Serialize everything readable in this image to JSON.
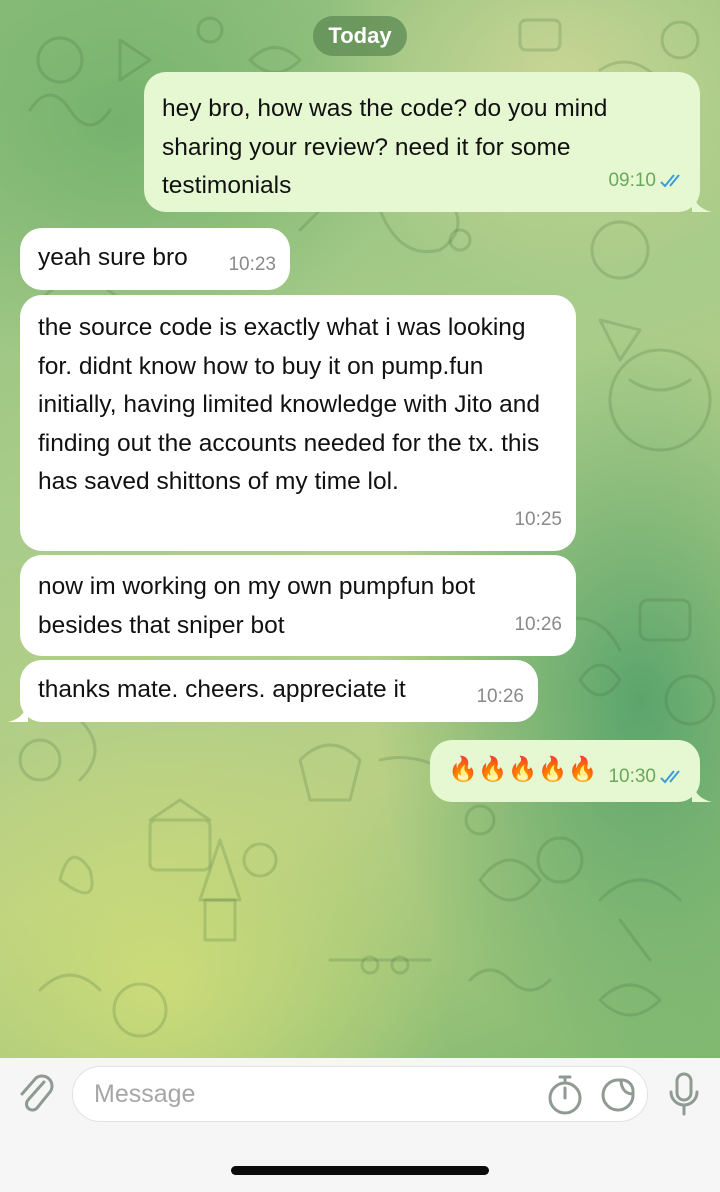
{
  "date_divider": "Today",
  "messages": [
    {
      "direction": "out",
      "text": "hey bro, how was the code? do you mind sharing your review? need it for some testimonials",
      "time": "09:10",
      "read": true
    },
    {
      "direction": "in",
      "text": "yeah sure bro",
      "time": "10:23"
    },
    {
      "direction": "in",
      "text": "the source code is exactly what i was looking for. didnt know how to buy it on pump.fun initially, having limited knowledge with Jito and finding out the accounts needed for the tx. this has saved shittons of my time lol.",
      "time": "10:25"
    },
    {
      "direction": "in",
      "text": "now im working on my own pumpfun bot besides that sniper bot",
      "time": "10:26"
    },
    {
      "direction": "in",
      "text": "thanks mate. cheers. appreciate it",
      "time": "10:26"
    },
    {
      "direction": "out",
      "text": "🔥🔥🔥🔥🔥",
      "time": "10:30",
      "read": true
    }
  ],
  "composer": {
    "placeholder": "Message",
    "icons": [
      "paperclip-icon",
      "stopwatch-icon",
      "sticker-icon",
      "microphone-icon"
    ]
  },
  "colors": {
    "outgoing_bubble": "#e5f8d2",
    "incoming_bubble": "#ffffff",
    "read_ticks": "#3f9bd6"
  }
}
